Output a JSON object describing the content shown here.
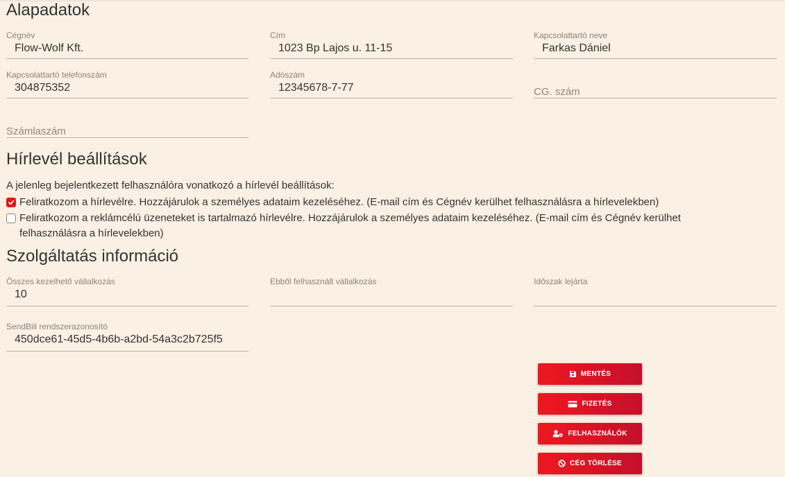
{
  "sections": {
    "basic": "Alapadatok",
    "newsletter": "Hírlevél beállítások",
    "service": "Szolgáltatás információ"
  },
  "basic": {
    "company_name": {
      "label": "Cégnév",
      "value": "Flow-Wolf Kft."
    },
    "address": {
      "label": "Cím",
      "value": "1023 Bp Lajos u. 11-15"
    },
    "contact_name": {
      "label": "Kapcsolattartó neve",
      "value": "Farkas Dániel"
    },
    "contact_phone": {
      "label": "Kapcsolattartó telefonszám",
      "value": "304875352"
    },
    "tax_number": {
      "label": "Adószám",
      "value": "12345678-7-77"
    },
    "cg_number": {
      "placeholder": "CG. szám",
      "value": ""
    },
    "account_number": {
      "placeholder": "Számlaszám",
      "value": ""
    }
  },
  "newsletter": {
    "intro": "A jelenleg bejelentkezett felhasználóra vonatkozó a hírlevél beállítások:",
    "option1": {
      "checked": true,
      "text": "Feliratkozom a hírlevélre. Hozzájárulok a személyes adataim kezeléséhez. (E-mail cím és Cégnév kerülhet felhasználásra a hírlevelekben)"
    },
    "option2": {
      "checked": false,
      "line1": "Feliratkozom a reklámcélú üzeneteket is tartalmazó hírlevélre. Hozzájárulok a személyes adataim kezeléséhez. (E-mail cím és Cégnév kerülhet",
      "line2": "felhasználásra a hírlevelekben)"
    }
  },
  "service": {
    "total": {
      "label": "Összes kezelhető vállalkozás",
      "value": "10"
    },
    "used": {
      "label": "Ebből felhasznált vállalkozás",
      "value": ""
    },
    "expiry": {
      "label": "Időszak lejárta",
      "value": ""
    },
    "sendbill_id": {
      "label": "SendBill rendszerazonosító",
      "value": "450dce61-45d5-4b6b-a2bd-54a3c2b725f5"
    }
  },
  "buttons": {
    "save": "MENTÉS",
    "payment": "FIZETÉS",
    "users": "FELHASZNÁLÓK",
    "delete_company": "CÉG TÖRLÉSE"
  },
  "colors": {
    "accent": "#e4161c",
    "background": "#faf0e3"
  },
  "icons": {
    "save": "floppy-disk-icon",
    "payment": "credit-card-icon",
    "users": "user-gear-icon",
    "delete": "ban-icon",
    "check": "check-icon"
  }
}
